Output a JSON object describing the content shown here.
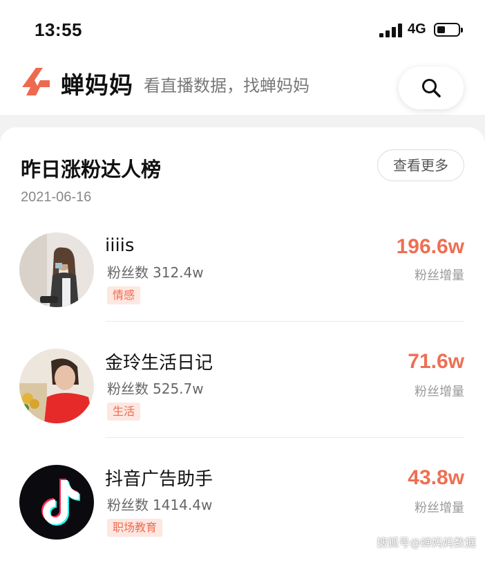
{
  "status_bar": {
    "time": "13:55",
    "network": "4G",
    "battery_level": 0.4
  },
  "header": {
    "brand": "蝉妈妈",
    "slogan": "看直播数据，找蝉妈妈",
    "logo_icon": "chanmama-logo-icon",
    "search_icon": "search-icon",
    "brand_color": "#ee6a4f"
  },
  "ranking": {
    "title": "昨日涨粉达人榜",
    "more_label": "查看更多",
    "date": "2021-06-16",
    "items": [
      {
        "name": "iiiis",
        "fans_label": "粉丝数",
        "fans_value": "312.4w",
        "tag": "情感",
        "gain_value": "196.6w",
        "gain_label": "粉丝增量"
      },
      {
        "name": "金玲生活日记",
        "fans_label": "粉丝数",
        "fans_value": "525.7w",
        "tag": "生活",
        "gain_value": "71.6w",
        "gain_label": "粉丝增量"
      },
      {
        "name": "抖音广告助手",
        "fans_label": "粉丝数",
        "fans_value": "1414.4w",
        "tag": "职场教育",
        "gain_value": "43.8w",
        "gain_label": "粉丝增量"
      }
    ]
  },
  "watermark": "搜狐号@蝉妈妈数据"
}
